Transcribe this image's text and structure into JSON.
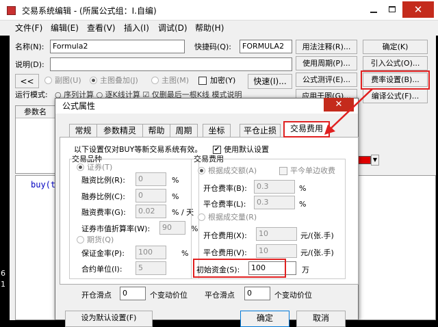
{
  "main_window": {
    "title": "交易系统编辑 - (所属公式组：I.自编)",
    "menu": [
      "文件(F)",
      "编辑(E)",
      "查看(V)",
      "插入(I)",
      "调试(D)",
      "帮助(H)"
    ],
    "name_label": "名称(N):",
    "name_value": "Formula2",
    "hotkey_label": "快捷码(Q):",
    "hotkey_value": "FORMULA2",
    "desc_label": "说明(D):",
    "nav_button": "<<",
    "radio_sub": "副图(U)",
    "radio_main_overlay": "主图叠加(J)",
    "radio_main": "主图(M)",
    "encrypt_label": "加密(Y)",
    "quick_button": "快速(I)...",
    "run_mode_label": "运行模式:",
    "run_mode_partial": "○ 序列计算  ○ 逐K线计算  ☑ 仅删最后一根K线  模式说明",
    "right_buttons": [
      "用法注释(R)...",
      "使用周期(P)...",
      "公式测评(E)...",
      "应用于图(G)..."
    ],
    "far_right_buttons": [
      "确定(K)",
      "引入公式(O)...",
      "费率设置(B)...",
      "编译公式(F)..."
    ],
    "param_header": "参数名",
    "code_text": "buy(t",
    "left_gutter_digits": [
      "6",
      "1"
    ]
  },
  "dialog": {
    "title": "公式属性",
    "close_symbol": "✕",
    "tabs": [
      "常规",
      "参数精灵",
      "帮助",
      "周期",
      "坐标",
      "平仓止损",
      "交易费用"
    ],
    "intro": "以下设置仅对BUY等新交易系统有效。",
    "use_default_label": "使用默认设置",
    "use_default_checked": "✔",
    "group_variety": "交易品种",
    "group_fee": "交易费用",
    "radio_security": "证券(T)",
    "radio_futures": "期货(Q)",
    "radio_by_amount": "根据成交额(A)",
    "radio_by_volume": "根据成交量(R)",
    "close_today_fee": "平今单边收费",
    "margin_loan_ratio_label": "融资比例(R):",
    "margin_loan_ratio": "0",
    "short_ratio_label": "融券比例(C):",
    "short_ratio": "0",
    "loan_fee_rate_label": "融资费率(G):",
    "loan_fee_rate": "0.02",
    "loan_fee_unit": "% / 天",
    "pct": "%",
    "market_discount_label": "证券市值折算率(W):",
    "market_discount": "90",
    "deposit_rate_label": "保证金率(P):",
    "deposit_rate": "100",
    "contract_unit_label": "合约单位(I):",
    "contract_unit": "5",
    "open_rate_label": "开仓费率(B):",
    "open_rate": "0.3",
    "close_rate_label": "平仓费率(L):",
    "close_rate": "0.3",
    "open_fee_label": "开仓费用(X):",
    "open_fee": "10",
    "close_fee_label": "平仓费用(V):",
    "close_fee": "10",
    "fee_unit": "元/(张.手)",
    "initial_capital_label": "初始资金(S):",
    "initial_capital": "100",
    "capital_unit": "万",
    "open_slip_label": "开仓滑点",
    "open_slip": "0",
    "close_slip_label": "平仓滑点",
    "close_slip": "0",
    "slip_unit": "个变动价位",
    "set_default_button": "设为默认设置(F)",
    "ok_button": "确定",
    "cancel_button": "取消"
  },
  "colors": {
    "highlight": "#e02020",
    "frame": "#f0f0f0",
    "code_text": "#0000c0",
    "dark_bg": "#000000"
  }
}
